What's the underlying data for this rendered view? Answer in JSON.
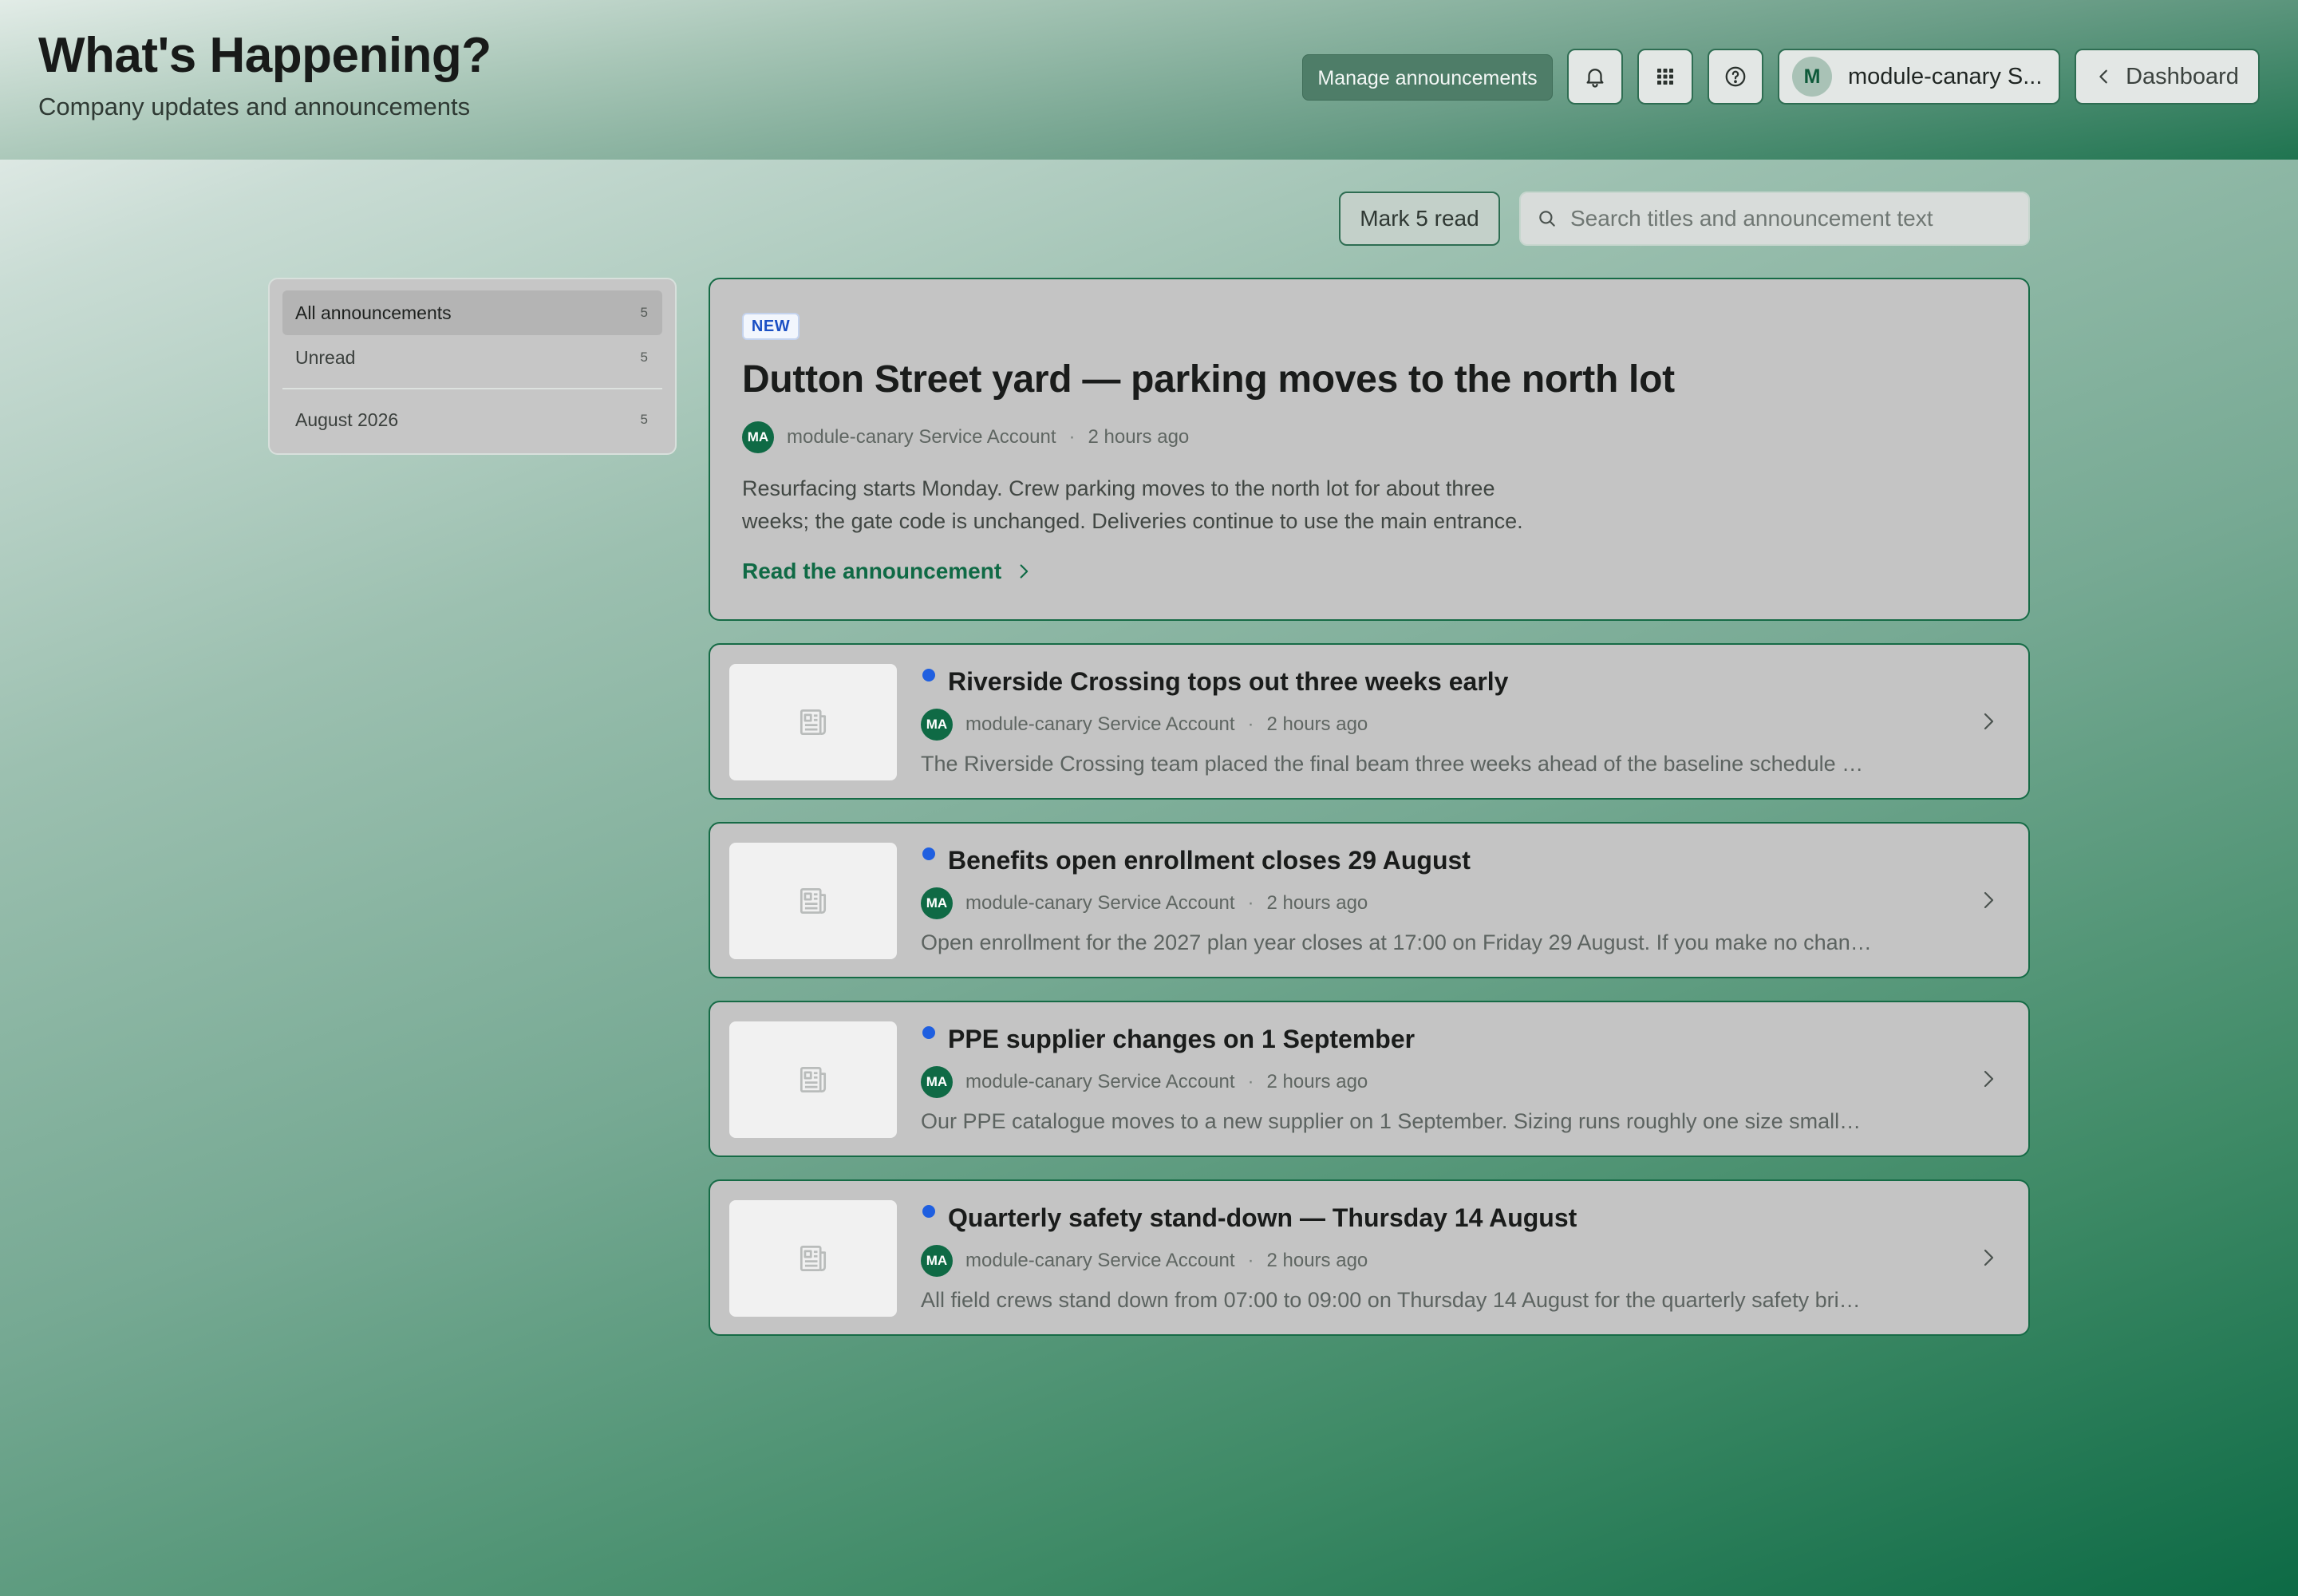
{
  "header": {
    "title": "What's Happening?",
    "subtitle": "Company updates and announcements",
    "manage_label": "Manage announcements",
    "user_initial": "M",
    "user_name": "module-canary S...",
    "dashboard_label": "Dashboard",
    "icons": [
      "bell-icon",
      "apps-grid-icon",
      "help-icon",
      "chevron-left-icon"
    ]
  },
  "toolbar": {
    "mark_read_label": "Mark 5 read",
    "search_placeholder": "Search titles and announcement text",
    "search_value": ""
  },
  "sidebar": {
    "items": [
      {
        "label": "All announcements",
        "count": "5",
        "active": true
      },
      {
        "label": "Unread",
        "count": "5",
        "active": false
      },
      {
        "label": "August 2026",
        "count": "5",
        "active": false
      }
    ]
  },
  "featured": {
    "badge": "NEW",
    "title": "Dutton Street yard — parking moves to the north lot",
    "avatar": "MA",
    "author": "module-canary Service Account",
    "separator": "·",
    "time": "2 hours ago",
    "body": "Resurfacing starts Monday. Crew parking moves to the north lot for about three weeks; the gate code is unchanged. Deliveries continue to use the main entrance.",
    "link_label": "Read the announcement"
  },
  "announcements": [
    {
      "title": "Riverside Crossing tops out three weeks early",
      "avatar": "MA",
      "author": "module-canary Service Account",
      "separator": "·",
      "time": "2 hours ago",
      "excerpt": "The Riverside Crossing team placed the final beam three weeks ahead of the baseline schedule and w…",
      "unread": true
    },
    {
      "title": "Benefits open enrollment closes 29 August",
      "avatar": "MA",
      "author": "module-canary Service Account",
      "separator": "·",
      "time": "2 hours ago",
      "excerpt": "Open enrollment for the 2027 plan year closes at 17:00 on Friday 29 August. If you make no changes, …",
      "unread": true
    },
    {
      "title": "PPE supplier changes on 1 September",
      "avatar": "MA",
      "author": "module-canary Service Account",
      "separator": "·",
      "time": "2 hours ago",
      "excerpt": "Our PPE catalogue moves to a new supplier on 1 September. Sizing runs roughly one size smaller for …",
      "unread": true
    },
    {
      "title": "Quarterly safety stand-down — Thursday 14 August",
      "avatar": "MA",
      "author": "module-canary Service Account",
      "separator": "·",
      "time": "2 hours ago",
      "excerpt": "All field crews stand down from 07:00 to 09:00 on Thursday 14 August for the quarterly safety briefing. …",
      "unread": true
    }
  ],
  "colors": {
    "brand_green": "#0f6a45",
    "unread_dot": "#1f5fe0",
    "badge_blue": "#1a4fc4"
  }
}
